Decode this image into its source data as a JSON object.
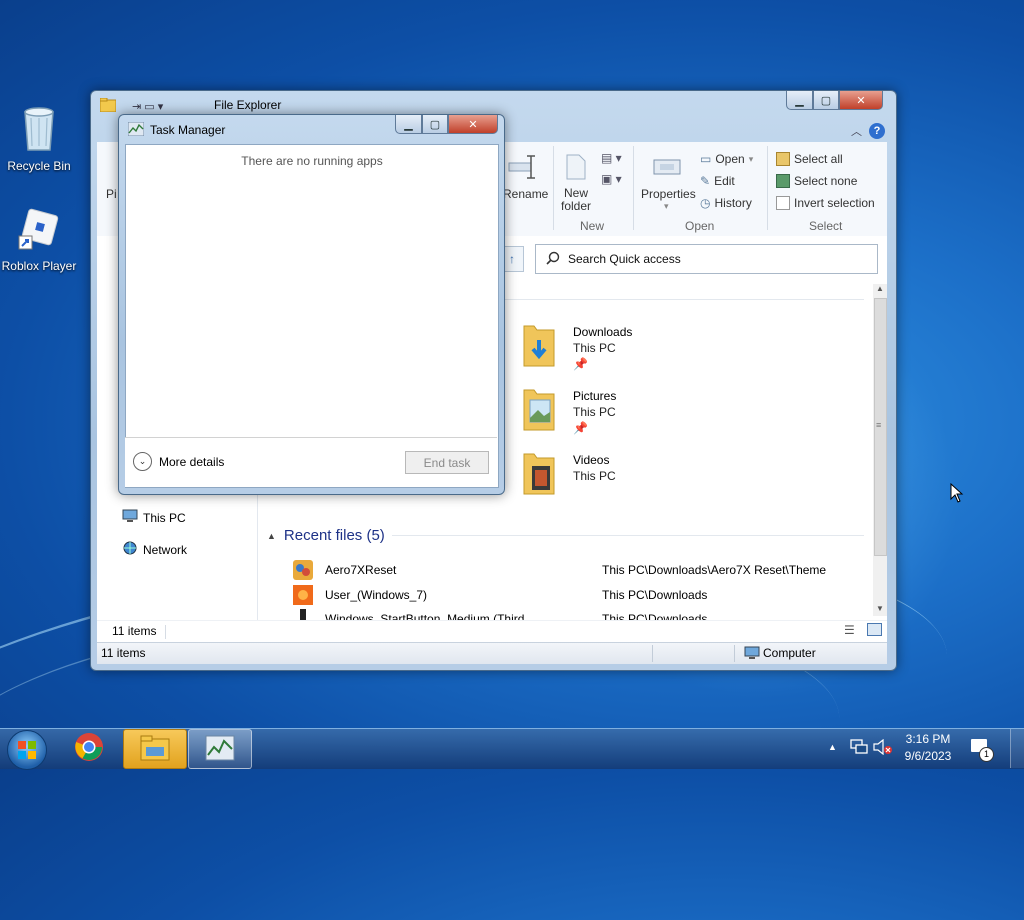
{
  "desktop": {
    "icons": [
      {
        "label": "Recycle Bin",
        "icon": "recycle-bin-icon"
      },
      {
        "label": "Roblox Player",
        "icon": "roblox-icon"
      }
    ]
  },
  "explorer": {
    "title": "File Explorer",
    "ribbon": {
      "pin_label": "Pi",
      "rename_label": "Rename",
      "new_folder_label": "New\nfolder",
      "properties_label": "Properties",
      "open_label": "Open",
      "edit_label": "Edit",
      "history_label": "History",
      "select_all_label": "Select all",
      "select_none_label": "Select none",
      "invert_selection_label": "Invert selection",
      "groups": {
        "new": "New",
        "open": "Open",
        "select": "Select"
      }
    },
    "search": {
      "placeholder": "Search Quick access"
    },
    "nav": [
      {
        "label": "This PC",
        "icon": "computer-icon"
      },
      {
        "label": "Network",
        "icon": "network-icon"
      }
    ],
    "frequent": [
      {
        "name": "Downloads",
        "location": "This PC",
        "pinned": true,
        "icon": "downloads-folder-icon"
      },
      {
        "name": "Pictures",
        "location": "This PC",
        "pinned": true,
        "icon": "pictures-folder-icon"
      },
      {
        "name": "Videos",
        "location": "This PC",
        "pinned": false,
        "icon": "videos-folder-icon"
      }
    ],
    "recent": {
      "header": "Recent files (5)",
      "rows": [
        {
          "name": "Aero7XReset",
          "path": "This PC\\Downloads\\Aero7X Reset\\Theme"
        },
        {
          "name": "User_(Windows_7)",
          "path": "This PC\\Downloads"
        },
        {
          "name": "Windows_StartButton_Medium (Third...",
          "path": "This PC\\Downloads"
        }
      ]
    },
    "status_inner": "11 items",
    "status_outer": "11 items",
    "status_location": "Computer"
  },
  "task_manager": {
    "title": "Task Manager",
    "empty_message": "There are no running apps",
    "more_details": "More details",
    "end_task": "End task"
  },
  "taskbar": {
    "time": "3:16 PM",
    "date": "9/6/2023",
    "notification_count": "1"
  }
}
